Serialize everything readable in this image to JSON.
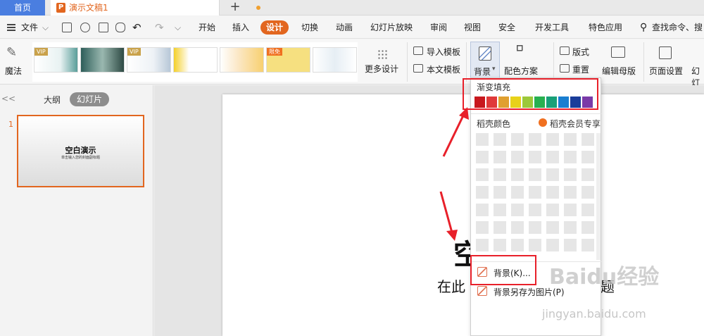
{
  "tabs": {
    "home": "首页",
    "doc_icon": "P",
    "doc_name": "演示文稿1",
    "add": "+"
  },
  "menu": {
    "file": "文件",
    "items": [
      "开始",
      "插入",
      "设计",
      "切换",
      "动画",
      "幻灯片放映",
      "审阅",
      "视图",
      "安全",
      "开发工具",
      "特色应用"
    ],
    "active": "设计",
    "search": "查找命令、搜索"
  },
  "ribbon": {
    "magic": "魔法",
    "thumb_badges": [
      "VIP",
      "VIP",
      "限免"
    ],
    "more_design": "更多设计",
    "import_template": "导入模板",
    "text_template": "本文模板",
    "background": "背景",
    "color_scheme": "配色方案",
    "layout": "版式",
    "reset": "重置",
    "edit_master": "编辑母版",
    "page_setup": "页面设置",
    "slide_cut": "幻灯"
  },
  "left_panel": {
    "collapse": "<<",
    "outline": "大纲",
    "slides": "幻灯片",
    "slide_number": "1",
    "thumb_title": "空白演示",
    "thumb_subtitle": "单击输入您的封面副标题"
  },
  "slide": {
    "title_partial": "空",
    "subtitle_left": "在此",
    "subtitle_right": "题"
  },
  "dropdown": {
    "gradient_fill": "渐变填充",
    "gradient_colors": [
      "#c8181e",
      "#e03a3a",
      "#e0a030",
      "#e8d21a",
      "#9cc83a",
      "#28b050",
      "#18a078",
      "#1a7ed0",
      "#1a3d9a",
      "#7a3aa8"
    ],
    "shell_colors": "稻壳颜色",
    "shell_member": "稻壳会员专享",
    "background_item": "背景(K)...",
    "save_background": "背景另存为图片(P)"
  },
  "watermark": {
    "main": "Baidu经验",
    "sub": "jingyan.baidu.com"
  }
}
